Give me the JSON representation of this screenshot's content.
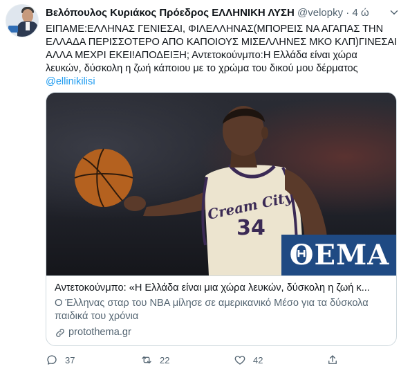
{
  "tweet": {
    "author_name": "Βελόπουλος Κυριάκος Πρόεδρος ΕΛΛΗΝΙΚΗ ΛΥΣΗ",
    "handle": "@velopky",
    "separator": "·",
    "time": "4 ώ",
    "text_lines": [
      "ΕΙΠΑΜΕ:ΕΛΛΗΝΑΣ ΓΕΝΙΕΣΑΙ, ΦΙΛΕΛΛΗΝΑΣ(ΜΠΟΡΕΙΣ ΝΑ ΑΓΑΠΑΣ ΤΗΝ",
      "ΕΛΛΑΔΑ ΠΕΡΙΣΣΟΤΕΡΟ ΑΠΟ ΚΑΠΟΙΟΥΣ ΜΙΣΕΛΛΗΝΕΣ ΜΚΟ ΚΛΠ)ΓΙΝΕΣΑΙ",
      "ΑΛΛΑ ΜΕΧΡΙ ΕΚΕΙ!ΑΠΟΔΕΙΞΗ; Αντετοκούνμπο:Η Ελλάδα είναι χώρα",
      "λευκών, δύσκολη η ζωή κάποιου με το χρώμα του δικού μου δέρματος"
    ],
    "mention": "@ellinikilisi"
  },
  "card": {
    "image_badge": "ΘΕΜΑ",
    "jersey_text": "Cream City",
    "jersey_number": "34",
    "title": "Αντετοκούνμπο: «Η Ελλάδα είναι μια χώρα λευκών, δύσκολη η ζωή κ...",
    "description": "Ο Έλληνας σταρ του NBA μίλησε σε αμερικανικό Μέσο για τα δύσκολα παιδικά του χρόνια",
    "domain": "protothema.gr"
  },
  "actions": {
    "reply_count": "37",
    "retweet_count": "22",
    "like_count": "42"
  },
  "colors": {
    "link": "#1d9bf0",
    "secondary_text": "#536471",
    "badge_bg": "#1f4a83"
  },
  "icons": [
    "reply-icon",
    "retweet-icon",
    "like-icon",
    "share-icon",
    "link-icon",
    "caret-down-icon"
  ]
}
